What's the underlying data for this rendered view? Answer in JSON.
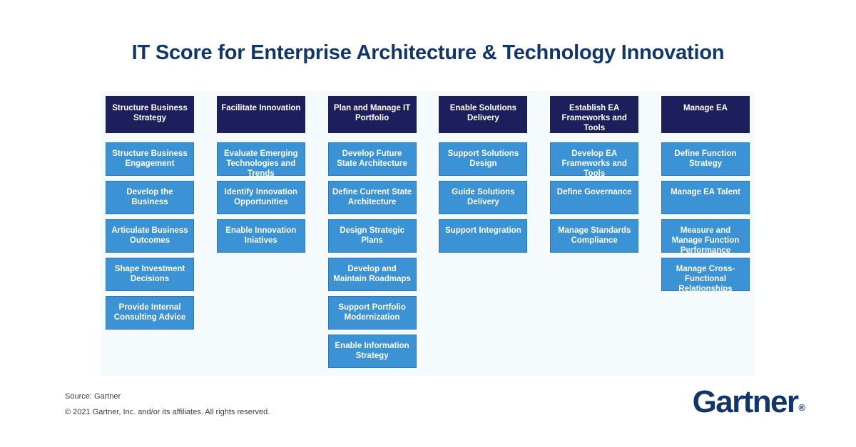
{
  "title": "IT Score for Enterprise Architecture & Technology Innovation",
  "colors": {
    "header_navy": "#1d1f5c",
    "cell_blue": "#3b92d4",
    "cell_border": "#2b7ab5",
    "panel_bg": "#f5fafd",
    "title_navy": "#11366b",
    "page_bg": "#ffffff"
  },
  "columns": [
    {
      "header": "Structure Business Strategy",
      "items": [
        "Structure Business Engagement",
        "Develop the Business",
        "Articulate Business Outcomes",
        "Shape Investment Decisions",
        "Provide Internal Consulting Advice"
      ]
    },
    {
      "header": "Facilitate Innovation",
      "items": [
        "Evaluate Emerging Technologies and Trends",
        "Identify Innovation Opportunities",
        "Enable Innovation Iniatives"
      ]
    },
    {
      "header": "Plan and Manage IT Portfolio",
      "items": [
        "Develop Future State Architecture",
        "Define Current State Architecture",
        "Design Strategic Plans",
        "Develop and Maintain Roadmaps",
        "Support Portfolio Modernization",
        "Enable Information Strategy"
      ]
    },
    {
      "header": "Enable Solutions Delivery",
      "items": [
        "Support Solutions Design",
        "Guide Solutions Delivery",
        "Support Integration"
      ]
    },
    {
      "header": "Establish EA Frameworks and Tools",
      "items": [
        "Develop EA Frameworks and Tools",
        "Define Governance",
        "Manage Standards Compliance"
      ]
    },
    {
      "header": "Manage EA",
      "items": [
        "Define Function Strategy",
        "Manage EA Talent",
        "Measure and Manage Function Performance",
        "Manage Cross-Functional Relationships"
      ]
    }
  ],
  "footer": {
    "source": "Source: Gartner",
    "copyright": "© 2021 Gartner, Inc. and/or its affiliates. All rights reserved.",
    "logo_text": "Gartner",
    "logo_mark": "®"
  }
}
